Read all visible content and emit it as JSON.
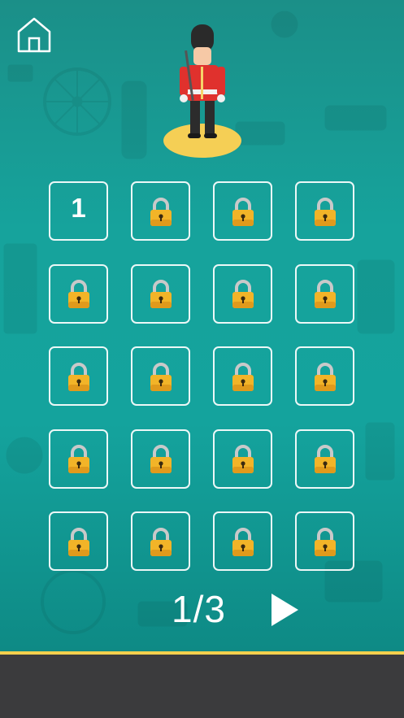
{
  "header": {
    "home_icon": "home-icon"
  },
  "mascot": {
    "figure": "queens-guard",
    "platform_color": "#f5cf55"
  },
  "levels": [
    {
      "state": "unlocked",
      "label": "1"
    },
    {
      "state": "locked"
    },
    {
      "state": "locked"
    },
    {
      "state": "locked"
    },
    {
      "state": "locked"
    },
    {
      "state": "locked"
    },
    {
      "state": "locked"
    },
    {
      "state": "locked"
    },
    {
      "state": "locked"
    },
    {
      "state": "locked"
    },
    {
      "state": "locked"
    },
    {
      "state": "locked"
    },
    {
      "state": "locked"
    },
    {
      "state": "locked"
    },
    {
      "state": "locked"
    },
    {
      "state": "locked"
    },
    {
      "state": "locked"
    },
    {
      "state": "locked"
    },
    {
      "state": "locked"
    },
    {
      "state": "locked"
    }
  ],
  "pager": {
    "indicator": "1/3",
    "next_icon": "play-next-icon"
  },
  "colors": {
    "background": "#16a39c",
    "tile_border": "#ffffff",
    "lock_body": "#f2b428",
    "lock_shackle": "#c9c9c9",
    "accent_line": "#f3cf4d",
    "bottom_bar": "#3b3b3d"
  }
}
